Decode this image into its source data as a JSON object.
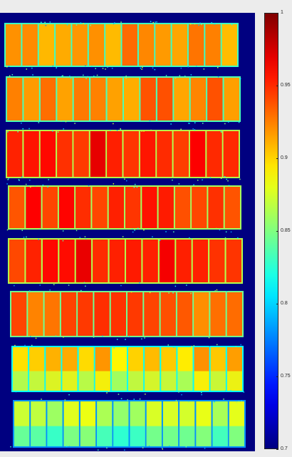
{
  "chart_data": {
    "type": "heatmap",
    "title": "",
    "xlabel": "",
    "ylabel": "",
    "colormap": "jet",
    "background_value": 0.7,
    "clim": [
      0.7,
      1.0
    ],
    "colorbar": {
      "ticks": [
        {
          "value": 1.0,
          "label": "1"
        },
        {
          "value": 0.95,
          "label": "0.95"
        },
        {
          "value": 0.9,
          "label": "0.9"
        },
        {
          "value": 0.85,
          "label": "0.85"
        },
        {
          "value": 0.8,
          "label": "0.8"
        },
        {
          "value": 0.75,
          "label": "0.75"
        },
        {
          "value": 0.7,
          "label": "0.7"
        }
      ]
    },
    "plot_rows": [
      {
        "row": 1,
        "plots": 14,
        "mean_value": 0.92
      },
      {
        "row": 2,
        "plots": 14,
        "mean_value": 0.925
      },
      {
        "row": 3,
        "plots": 14,
        "mean_value": 0.955
      },
      {
        "row": 4,
        "plots": 14,
        "mean_value": 0.95
      },
      {
        "row": 5,
        "plots": 14,
        "mean_value": 0.955
      },
      {
        "row": 6,
        "plots": 14,
        "mean_value": 0.935
      },
      {
        "row": 7,
        "plots": 14,
        "mean_value": 0.905
      },
      {
        "row": 8,
        "plots": 14,
        "mean_value": 0.87
      }
    ]
  }
}
